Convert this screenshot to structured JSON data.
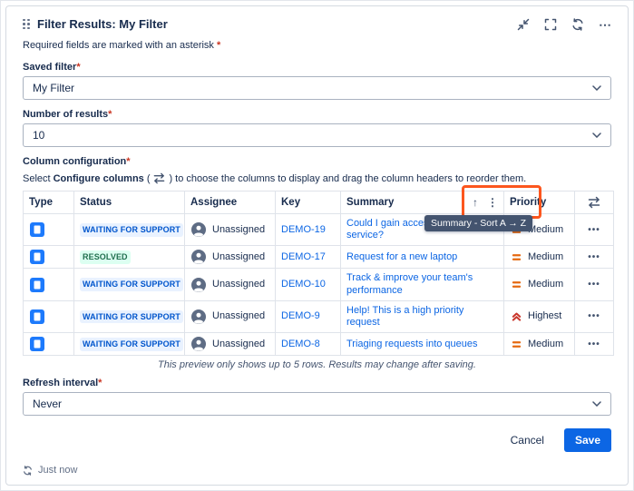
{
  "colors": {
    "accent_blue": "#0C66E4",
    "highlight_orange": "#FC561E",
    "status_blue_text": "#0055CC",
    "status_blue_bg": "#E9F2FF",
    "status_green_text": "#216E4E",
    "status_green_bg": "#DCFFF1",
    "priority_medium_orange": "#E56910",
    "priority_highest_red": "#C9372C",
    "tooltip_bg": "#44546F"
  },
  "header": {
    "title": "Filter Results: My Filter",
    "more_label": "⋯"
  },
  "required_note": {
    "text": "Required fields are marked with an asterisk",
    "asterisk": "*"
  },
  "saved_filter": {
    "label": "Saved filter",
    "required": "*",
    "value": "My Filter"
  },
  "number_of_results": {
    "label": "Number of results",
    "required": "*",
    "value": "10"
  },
  "column_configuration": {
    "label": "Column configuration",
    "required": "*",
    "help_before": "Select",
    "help_bold": "Configure columns",
    "help_paren_open": "(",
    "help_paren_close": ")",
    "help_after": "to choose the columns to display and drag the column headers to reorder them."
  },
  "table": {
    "columns": {
      "type": "Type",
      "status": "Status",
      "assignee": "Assignee",
      "key": "Key",
      "summary": "Summary",
      "priority": "Priority"
    },
    "sort_arrow": "↑",
    "kebab": "⋮",
    "sort_tooltip": "Summary - Sort A → Z",
    "row_more_label": "•••",
    "rows": [
      {
        "status": "WAITING FOR SUPPORT",
        "assignee": "Unassigned",
        "key": "DEMO-19",
        "summary": "Could I gain access to this service?",
        "priority": "Medium"
      },
      {
        "status": "RESOLVED",
        "assignee": "Unassigned",
        "key": "DEMO-17",
        "summary": "Request for a new laptop",
        "priority": "Medium"
      },
      {
        "status": "WAITING FOR SUPPORT",
        "assignee": "Unassigned",
        "key": "DEMO-10",
        "summary": "Track & improve your team's performance",
        "priority": "Medium"
      },
      {
        "status": "WAITING FOR SUPPORT",
        "assignee": "Unassigned",
        "key": "DEMO-9",
        "summary": "Help! This is a high priority request",
        "priority": "Highest"
      },
      {
        "status": "WAITING FOR SUPPORT",
        "assignee": "Unassigned",
        "key": "DEMO-8",
        "summary": "Triaging requests into queues",
        "priority": "Medium"
      }
    ],
    "preview_note": "This preview only shows up to 5 rows. Results may change after saving."
  },
  "refresh_interval": {
    "label": "Refresh interval",
    "required": "*",
    "value": "Never"
  },
  "footer_actions": {
    "cancel": "Cancel",
    "save": "Save"
  },
  "status_bar": {
    "last_refreshed": "Just now"
  }
}
